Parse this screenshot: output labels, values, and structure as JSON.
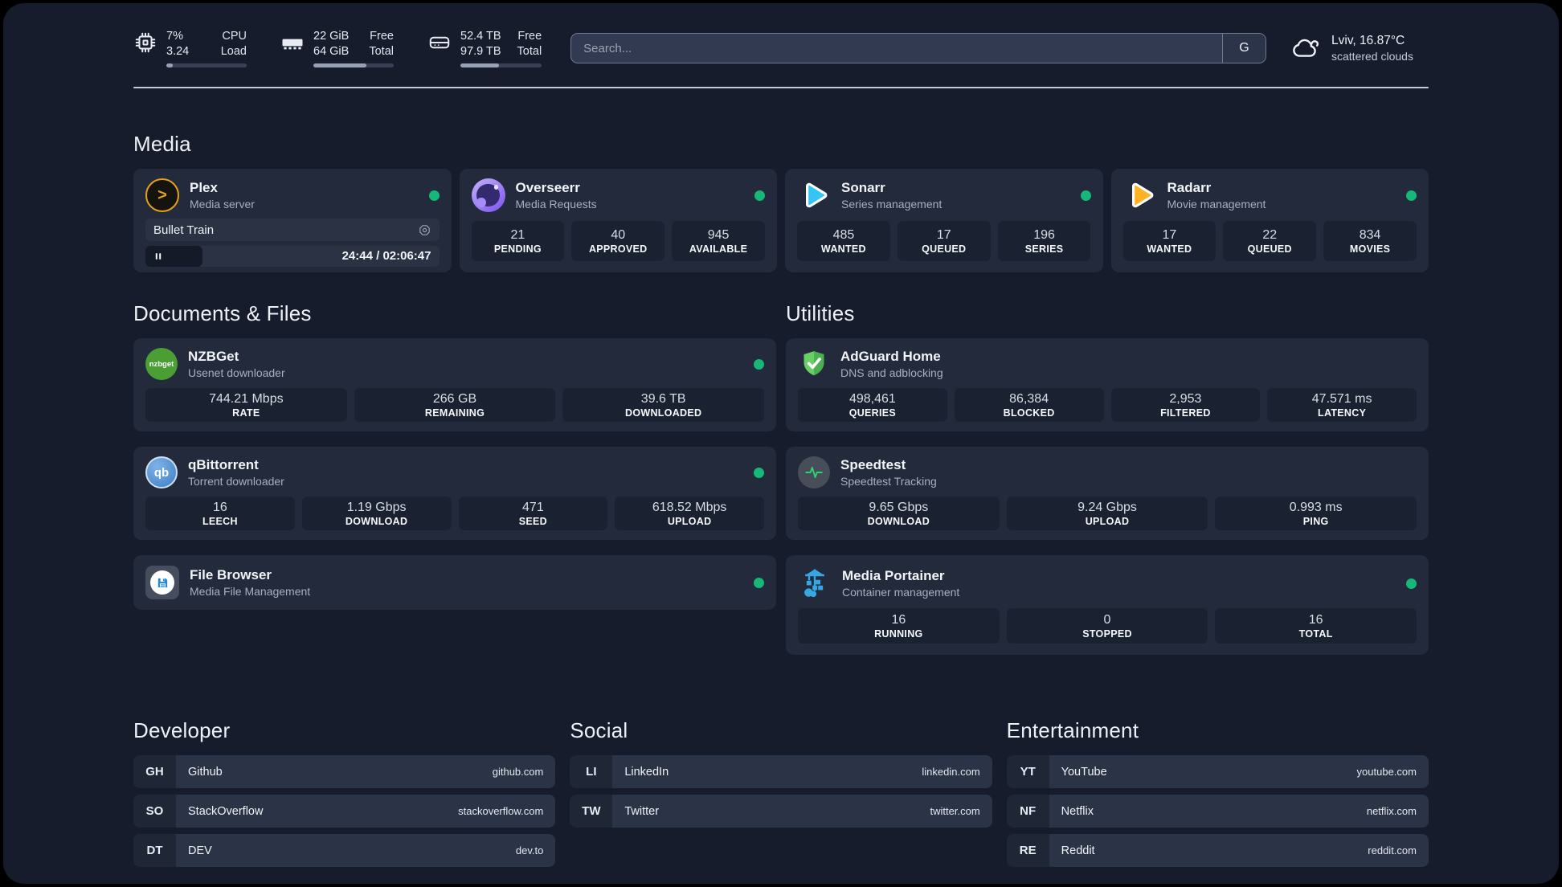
{
  "colors": {
    "status_online": "#17b877",
    "page_bg": "#161c2c",
    "card_bg": "#222a3b",
    "accent_plex": "#e8a116",
    "accent_overseerr": "#8b5cf6",
    "accent_sonarr": "#35c5f4",
    "accent_radarr": "#ffb224",
    "accent_nzbget": "#4a9e33",
    "accent_qbittorrent": "#4285c9",
    "accent_filebrowser": "#1e88e5",
    "accent_adguard": "#5dbf5a",
    "accent_speedtest": "#2dd36f",
    "accent_portainer": "#36a7e0"
  },
  "topbar": {
    "cpu": {
      "usage": "7%",
      "load": "3.24",
      "label_top": "CPU",
      "label_bottom": "Load",
      "progress_width": "8%"
    },
    "ram": {
      "free": "22 GiB",
      "total": "64 GiB",
      "label_top": "Free",
      "label_bottom": "Total",
      "progress_width": "66%"
    },
    "disk": {
      "free": "52.4 TB",
      "total": "97.9 TB",
      "label_top": "Free",
      "label_bottom": "Total",
      "progress_width": "47%"
    },
    "search": {
      "placeholder": "Search...",
      "engine_button": "G"
    },
    "weather": {
      "location_temp": "Lviv, 16.87°C",
      "condition": "scattered clouds"
    }
  },
  "sections": {
    "media": "Media",
    "documents": "Documents & Files",
    "utilities": "Utilities",
    "developer": "Developer",
    "social": "Social",
    "entertainment": "Entertainment"
  },
  "apps": {
    "plex": {
      "title": "Plex",
      "subtitle": "Media server",
      "icon_glyph": ">",
      "now_playing": {
        "title": "Bullet Train",
        "time_display": "24:44 / 02:06:47",
        "progress_width": "19.5%"
      }
    },
    "overseerr": {
      "title": "Overseerr",
      "subtitle": "Media Requests",
      "stats": [
        {
          "value": "21",
          "label": "PENDING"
        },
        {
          "value": "40",
          "label": "APPROVED"
        },
        {
          "value": "945",
          "label": "AVAILABLE"
        }
      ]
    },
    "sonarr": {
      "title": "Sonarr",
      "subtitle": "Series management",
      "stats": [
        {
          "value": "485",
          "label": "WANTED"
        },
        {
          "value": "17",
          "label": "QUEUED"
        },
        {
          "value": "196",
          "label": "SERIES"
        }
      ]
    },
    "radarr": {
      "title": "Radarr",
      "subtitle": "Movie management",
      "stats": [
        {
          "value": "17",
          "label": "WANTED"
        },
        {
          "value": "22",
          "label": "QUEUED"
        },
        {
          "value": "834",
          "label": "MOVIES"
        }
      ]
    },
    "nzbget": {
      "title": "NZBGet",
      "subtitle": "Usenet downloader",
      "icon_text": "nzbget",
      "stats": [
        {
          "value": "744.21 Mbps",
          "label": "RATE"
        },
        {
          "value": "266 GB",
          "label": "REMAINING"
        },
        {
          "value": "39.6 TB",
          "label": "DOWNLOADED"
        }
      ]
    },
    "qbittorrent": {
      "title": "qBittorrent",
      "subtitle": "Torrent downloader",
      "icon_text": "qb",
      "stats": [
        {
          "value": "16",
          "label": "LEECH"
        },
        {
          "value": "1.19 Gbps",
          "label": "DOWNLOAD"
        },
        {
          "value": "471",
          "label": "SEED"
        },
        {
          "value": "618.52 Mbps",
          "label": "UPLOAD"
        }
      ]
    },
    "filebrowser": {
      "title": "File Browser",
      "subtitle": "Media File Management"
    },
    "adguard": {
      "title": "AdGuard Home",
      "subtitle": "DNS and adblocking",
      "stats": [
        {
          "value": "498,461",
          "label": "QUERIES"
        },
        {
          "value": "86,384",
          "label": "BLOCKED"
        },
        {
          "value": "2,953",
          "label": "FILTERED"
        },
        {
          "value": "47.571 ms",
          "label": "LATENCY"
        }
      ]
    },
    "speedtest": {
      "title": "Speedtest",
      "subtitle": "Speedtest Tracking",
      "stats": [
        {
          "value": "9.65 Gbps",
          "label": "DOWNLOAD"
        },
        {
          "value": "9.24 Gbps",
          "label": "UPLOAD"
        },
        {
          "value": "0.993 ms",
          "label": "PING"
        }
      ]
    },
    "portainer": {
      "title": "Media Portainer",
      "subtitle": "Container management",
      "stats": [
        {
          "value": "16",
          "label": "RUNNING"
        },
        {
          "value": "0",
          "label": "STOPPED"
        },
        {
          "value": "16",
          "label": "TOTAL"
        }
      ]
    }
  },
  "bookmarks": {
    "developer": [
      {
        "abbr": "GH",
        "name": "Github",
        "url": "github.com"
      },
      {
        "abbr": "SO",
        "name": "StackOverflow",
        "url": "stackoverflow.com"
      },
      {
        "abbr": "DT",
        "name": "DEV",
        "url": "dev.to"
      }
    ],
    "social": [
      {
        "abbr": "LI",
        "name": "LinkedIn",
        "url": "linkedin.com"
      },
      {
        "abbr": "TW",
        "name": "Twitter",
        "url": "twitter.com"
      }
    ],
    "entertainment": [
      {
        "abbr": "YT",
        "name": "YouTube",
        "url": "youtube.com"
      },
      {
        "abbr": "NF",
        "name": "Netflix",
        "url": "netflix.com"
      },
      {
        "abbr": "RE",
        "name": "Reddit",
        "url": "reddit.com"
      }
    ]
  }
}
